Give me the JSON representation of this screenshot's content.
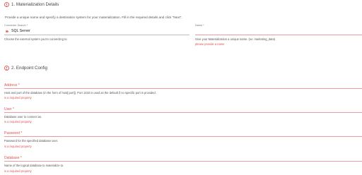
{
  "section1": {
    "title": "1. Materialization Details",
    "intro": "Provide a unique name and specify a destination system for your materialization. Fill in the required details and click \"Next\".",
    "connector": {
      "label": "Connector Search *",
      "value": "SQL Server",
      "help": "Choose the external system you're connecting to."
    },
    "name": {
      "label": "Name *",
      "value": "",
      "help": "Give your Materialization a unique name. (ex: marketing_data)",
      "error": "please provide a name"
    }
  },
  "section2": {
    "title": "2. Endpoint Config",
    "fields": [
      {
        "label": "Address *",
        "help": "Host and port of the database (in the form of host[:port]). Port 1433 is used as the default if no specific port is provided.",
        "error": "is a required property"
      },
      {
        "label": "User *",
        "help": "Database user to connect as.",
        "error": "is a required property"
      },
      {
        "label": "Password *",
        "help": "Password for the specified database user.",
        "error": "is a required property"
      },
      {
        "label": "Database *",
        "help": "Name of the logical database to materialize to.",
        "error": "is a required property"
      }
    ]
  },
  "colors": {
    "error": "#d9534f",
    "underline_error": "#ee9aa6",
    "underline_normal": "#bdbdbd"
  },
  "icons": {
    "section": "info-circle-icon",
    "connector": "sqlserver-flag-icon"
  }
}
